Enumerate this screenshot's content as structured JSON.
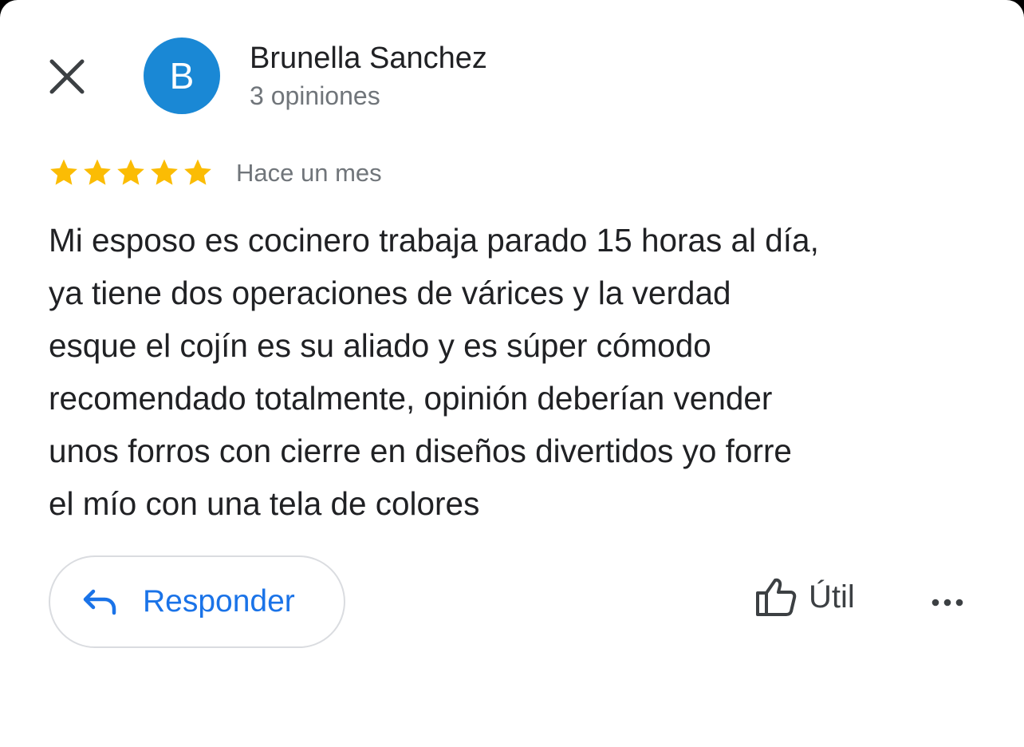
{
  "reviewer": {
    "avatar_initial": "B",
    "avatar_color": "#1a88d5",
    "name": "Brunella Sanchez",
    "review_count": "3 opiniones"
  },
  "review": {
    "rating": 5,
    "max_rating": 5,
    "star_color": "#fbbc04",
    "time": "Hace un mes",
    "lines": [
      "Mi esposo es cocinero trabaja parado 15 horas al día,",
      "ya tiene dos operaciones de várices y la verdad",
      "esque el cojín es su aliado y es súper cómodo",
      "recomendado totalmente, opinión deberían vender",
      "unos forros con cierre en diseños divertidos yo forre",
      "el mío con una tela de colores"
    ]
  },
  "actions": {
    "reply_label": "Responder",
    "helpful_label": "Útil",
    "accent_color": "#1a73e8"
  },
  "icons": {
    "close": "close-icon",
    "reply": "reply-arrow-icon",
    "helpful": "thumbs-up-icon",
    "more": "more-horizontal-icon"
  }
}
